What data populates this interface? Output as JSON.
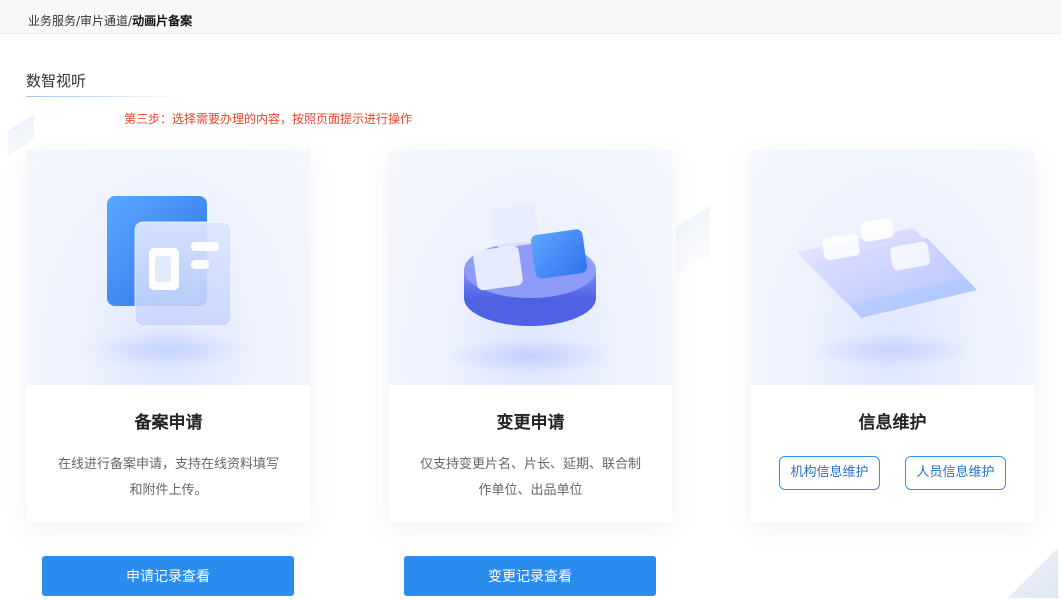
{
  "breadcrumb": {
    "part1": "业务服务/",
    "part2": "审片通道/",
    "current": "动画片备案"
  },
  "section": {
    "title": "数智视听"
  },
  "step_tip": "第三步：选择需要办理的内容，按照页面提示进行操作",
  "cards": {
    "filing": {
      "title": "备案申请",
      "desc": "在线进行备案申请，支持在线资料填写和附件上传。",
      "illustration": "document-card-icon"
    },
    "change": {
      "title": "变更申请",
      "desc": "仅支持变更片名、片长、延期、联合制作单位、出品单位",
      "illustration": "stacked-blocks-icon"
    },
    "info": {
      "title": "信息维护",
      "org_button": "机构信息维护",
      "person_button": "人员信息维护",
      "illustration": "layered-platform-icon"
    }
  },
  "buttons": {
    "apply_records": "申请记录查看",
    "change_records": "变更记录查看"
  },
  "colors": {
    "primary": "#2b8cf0",
    "warning_text": "#e8462f",
    "outline_button": "#3a8ee6"
  }
}
